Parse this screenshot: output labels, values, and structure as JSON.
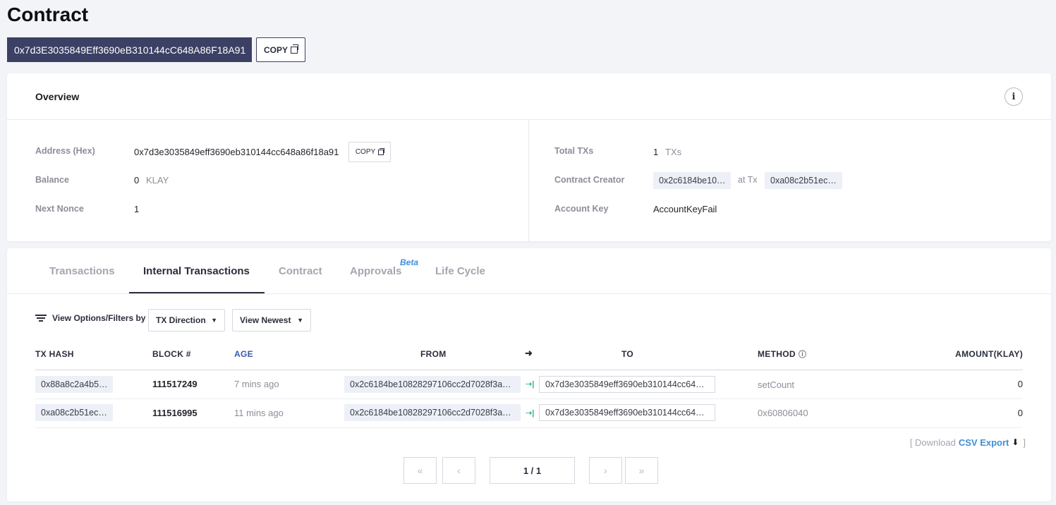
{
  "page": {
    "title": "Contract",
    "address": "0x7d3E3035849Eff3690eB310144cC648A86F18A91",
    "copy_label": "COPY"
  },
  "overview": {
    "title": "Overview",
    "info_icon": "i",
    "left": {
      "address_label": "Address (Hex)",
      "address_value": "0x7d3e3035849eff3690eb310144cc648a86f18a91",
      "copy_label": "COPY",
      "balance_label": "Balance",
      "balance_value": "0",
      "balance_unit": "KLAY",
      "nonce_label": "Next Nonce",
      "nonce_value": "1"
    },
    "right": {
      "total_label": "Total TXs",
      "total_value": "1",
      "total_unit": "TXs",
      "creator_label": "Contract Creator",
      "creator_value": "0x2c6184be10…",
      "at_tx_label": "at Tx",
      "creator_tx": "0xa08c2b51ec…",
      "key_label": "Account Key",
      "key_value": "AccountKeyFail"
    }
  },
  "tabs": [
    {
      "label": "Transactions"
    },
    {
      "label": "Internal Transactions"
    },
    {
      "label": "Contract"
    },
    {
      "label": "Approvals"
    },
    {
      "label": "Life Cycle"
    }
  ],
  "beta_label": "Beta",
  "filters": {
    "label": "View Options/Filters by",
    "direction": "TX Direction",
    "sort": "View Newest"
  },
  "table": {
    "headers": {
      "hash": "TX HASH",
      "block": "BLOCK #",
      "age": "AGE",
      "from": "FROM",
      "to": "TO",
      "method": "METHOD",
      "amount": "AMOUNT(KLAY)"
    },
    "rows": [
      {
        "hash": "0x88a8c2a4b5…",
        "block": "111517249",
        "age": "7 mins ago",
        "from": "0x2c6184be10828297106cc2d7028f3a…",
        "to": "0x7d3e3035849eff3690eb310144cc64…",
        "method": "setCount",
        "amount": "0"
      },
      {
        "hash": "0xa08c2b51ec…",
        "block": "111516995",
        "age": "11 mins ago",
        "from": "0x2c6184be10828297106cc2d7028f3a…",
        "to": "0x7d3e3035849eff3690eb310144cc64…",
        "method": "0x60806040",
        "amount": "0"
      }
    ]
  },
  "export": {
    "prefix": "[ Download",
    "link": "CSV Export",
    "suffix": "]"
  },
  "pagination": {
    "info": "1 / 1",
    "first": "«",
    "prev": "‹",
    "next": "›",
    "last": "»"
  }
}
